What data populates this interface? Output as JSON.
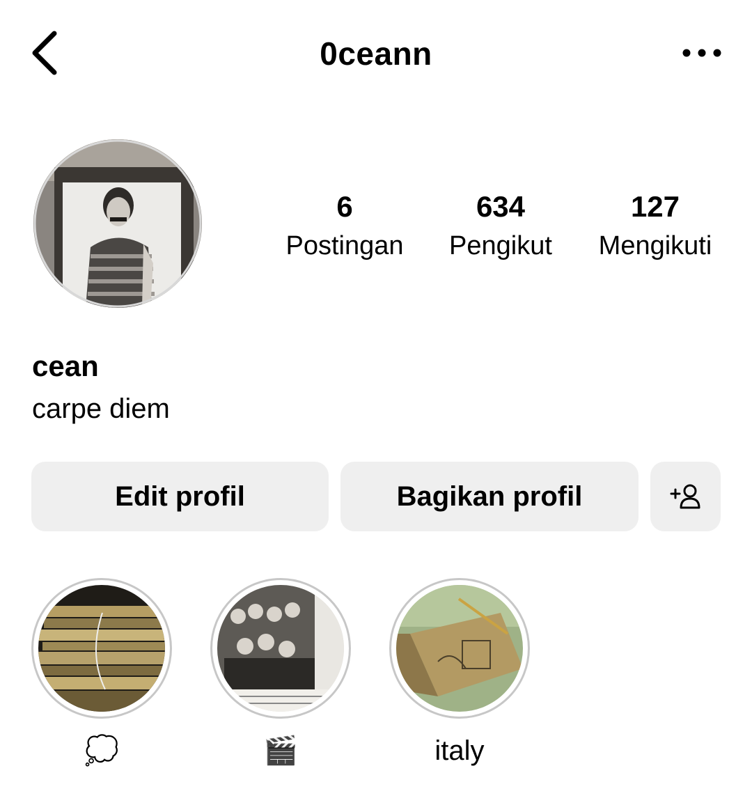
{
  "header": {
    "username": "0ceann",
    "back_icon": "chevron-left-icon",
    "more_icon": "more-horizontal-icon"
  },
  "profile": {
    "stats": [
      {
        "count": "6",
        "label": "Postingan"
      },
      {
        "count": "634",
        "label": "Pengikut"
      },
      {
        "count": "127",
        "label": "Mengikuti"
      }
    ],
    "display_name": "cean",
    "bio": "carpe diem"
  },
  "actions": {
    "edit_label": "Edit profil",
    "share_label": "Bagikan profil",
    "add_person_icon": "add-person-icon"
  },
  "highlights": [
    {
      "label": "💭"
    },
    {
      "label": "🎬"
    },
    {
      "label": "italy"
    }
  ],
  "colors": {
    "button_bg": "#efefef",
    "highlight_ring": "#c7c7c7"
  }
}
